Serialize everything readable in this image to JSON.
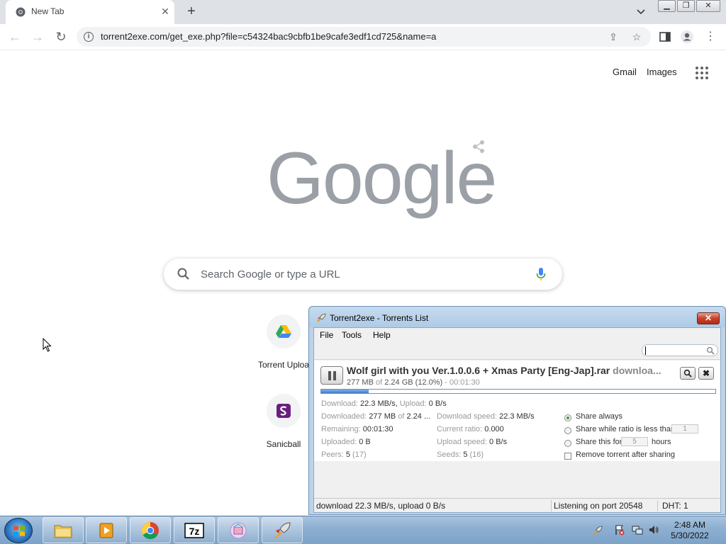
{
  "browser": {
    "tab_title": "New Tab",
    "url": "torrent2exe.com/get_exe.php?file=c54324bac9cbfb1be9cafe3edf1cd725&name=a"
  },
  "ntp": {
    "links": [
      "Gmail",
      "Images"
    ],
    "logo_text": "Google",
    "search_placeholder": "Search Google or type a URL",
    "shortcuts": [
      {
        "label": "Torrent Uploa",
        "icon": "google-drive-icon"
      },
      {
        "label": "Sanicball",
        "icon": "sanicball-icon"
      }
    ]
  },
  "torrent_window": {
    "title": "Torrent2exe - Torrents List",
    "menus": [
      "File",
      "Tools",
      "Help"
    ],
    "torrent": {
      "name": "Wolf girl with you Ver.1.0.0.6 + Xmas Party [Eng-Jap].rar",
      "status": "downloa...",
      "downloaded_size": "277 MB",
      "of_word": "of",
      "total_size": "2.24 GB",
      "percent_text": "(12.0%)",
      "eta_text": "- 00:01:30",
      "progress": 0.12
    },
    "stats": {
      "download_label": "Download:",
      "download_value": "22.3 MB/s,",
      "upload_label": "Upload:",
      "upload_value": "0 B/s",
      "downloaded_label": "Downloaded:",
      "downloaded_value": "277 MB",
      "downloaded_of": "of",
      "downloaded_total": "2.24 ...",
      "remaining_label": "Remaining:",
      "remaining_value": "00:01:30",
      "uploaded_label": "Uploaded:",
      "uploaded_value": "0 B",
      "peers_label": "Peers:",
      "peers_value": "5",
      "peers_total": "(17)",
      "dl_speed_label": "Download speed:",
      "dl_speed_value": "22.3 MB/s",
      "ratio_label": "Current ratio:",
      "ratio_value": "0.000",
      "ul_speed_label": "Upload speed:",
      "ul_speed_value": "0 B/s",
      "seeds_label": "Seeds:",
      "seeds_value": "5",
      "seeds_total": "(16)"
    },
    "sharing": {
      "share_always": "Share always",
      "share_ratio": "Share while ratio is less than",
      "share_ratio_value": "1",
      "share_for": "Share this for",
      "share_for_value": "5",
      "share_for_unit": "hours",
      "remove_after": "Remove torrent after sharing"
    },
    "statusbar": {
      "speeds": "download 22.3 MB/s, upload 0 B/s",
      "port": "Listening on port 20548",
      "dht": "DHT: 1"
    }
  },
  "taskbar": {
    "time": "2:48 AM",
    "date": "5/30/2022"
  }
}
